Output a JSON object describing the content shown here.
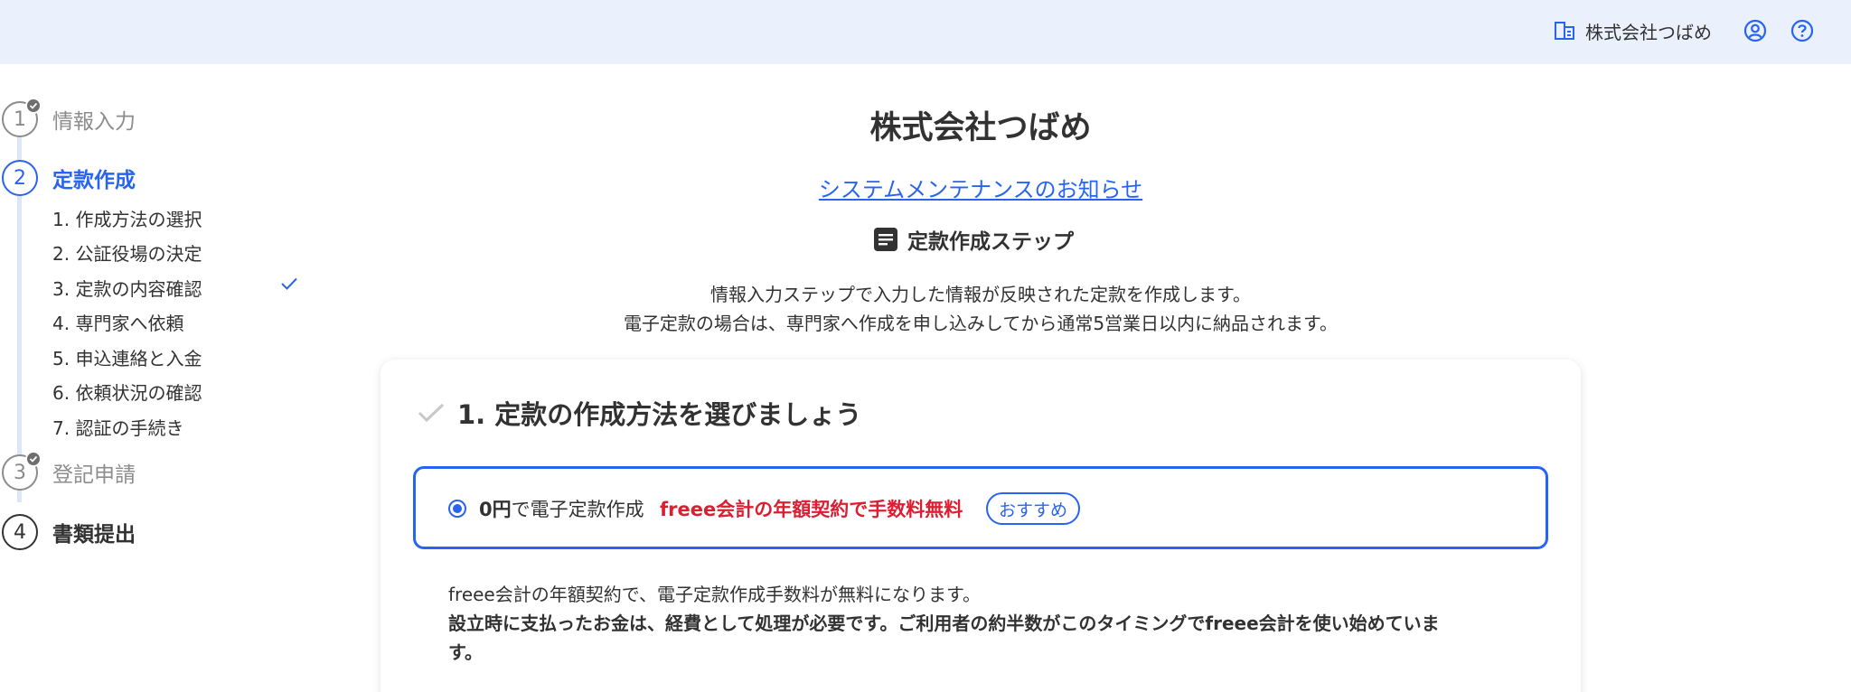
{
  "header": {
    "company_name": "株式会社つばめ",
    "icons": [
      "company-icon",
      "account-icon",
      "help-icon"
    ]
  },
  "sidebar": {
    "steps": [
      {
        "number": "1",
        "label": "情報入力",
        "state": "done"
      },
      {
        "number": "2",
        "label": "定款作成",
        "state": "active"
      },
      {
        "number": "3",
        "label": "登記申請",
        "state": "done"
      },
      {
        "number": "4",
        "label": "書類提出",
        "state": "pending"
      }
    ],
    "substeps": [
      "1. 作成方法の選択",
      "2. 公証役場の決定",
      "3. 定款の内容確認",
      "4. 専門家へ依頼",
      "5. 申込連絡と入金",
      "6. 依頼状況の確認",
      "7. 認証の手続き"
    ],
    "checked_substep": "3. 定款の内容確認"
  },
  "main": {
    "title": "株式会社つばめ",
    "maintenance_link": "システムメンテナンスのお知らせ",
    "step_heading": "定款作成ステップ",
    "description_line1": "情報入力ステップで入力した情報が反映された定款を作成します。",
    "description_line2": "電子定款の場合は、専門家へ作成を申し込みしてから通常5営業日以内に納品されます。"
  },
  "card": {
    "title": "1. 定款の作成方法を選びましょう",
    "option": {
      "zero_yen": "0円",
      "label_rest": "で電子定款作成",
      "promo": "freee会計の年額契約で手数料無料",
      "badge": "おすすめ",
      "selected": true
    },
    "text_line1": "freee会計の年額契約で、電子定款作成手数料が無料になります。",
    "text_line2": "設立時に支払ったお金は、経費として処理が必要です。ご利用者の約半数がこのタイミングでfreee会計を使い始めていま",
    "text_line3": "す。"
  },
  "colors": {
    "header_bg": "#eaf0fc",
    "accent": "#2864f0",
    "promo_red": "#dc1e32",
    "text": "#323232",
    "done_gray": "#8c8c8c"
  }
}
